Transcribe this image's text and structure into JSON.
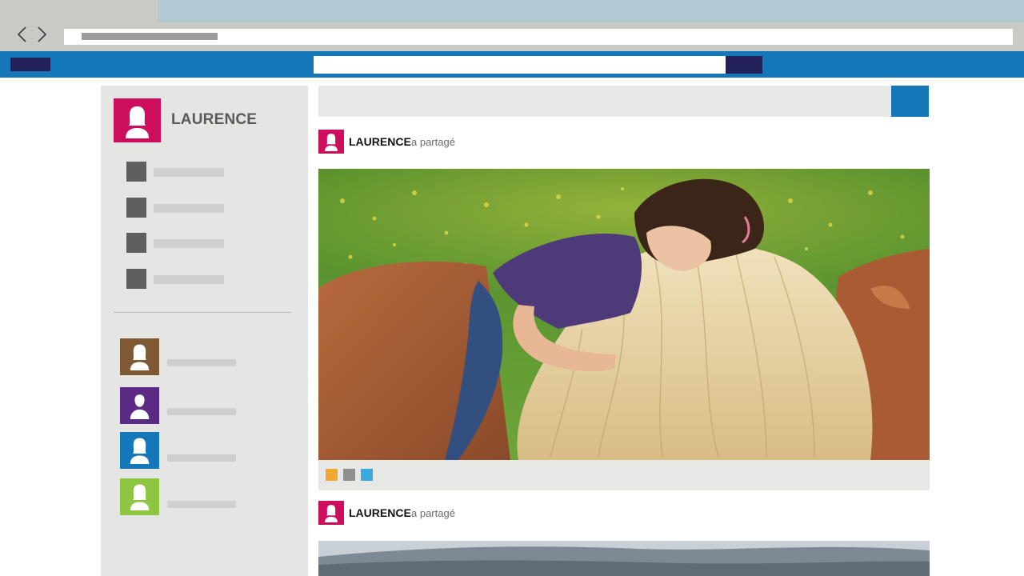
{
  "user": {
    "name": "LAURENCE"
  },
  "feed": {
    "posts": [
      {
        "author": "LAURENCE",
        "action": "a partagé"
      },
      {
        "author": "LAURENCE",
        "action": "a partagé"
      }
    ]
  },
  "colors": {
    "header_blue": "#1477b8",
    "navy": "#22225a",
    "avatar_pink": "#cc0e5c",
    "friend_brown": "#7e5a34",
    "friend_purple": "#5b2a85",
    "friend_blue": "#1477b8",
    "friend_green": "#8fc641",
    "reaction_orange": "#f0a830",
    "reaction_gray": "#8f8f8f",
    "reaction_blue": "#39a9df"
  }
}
